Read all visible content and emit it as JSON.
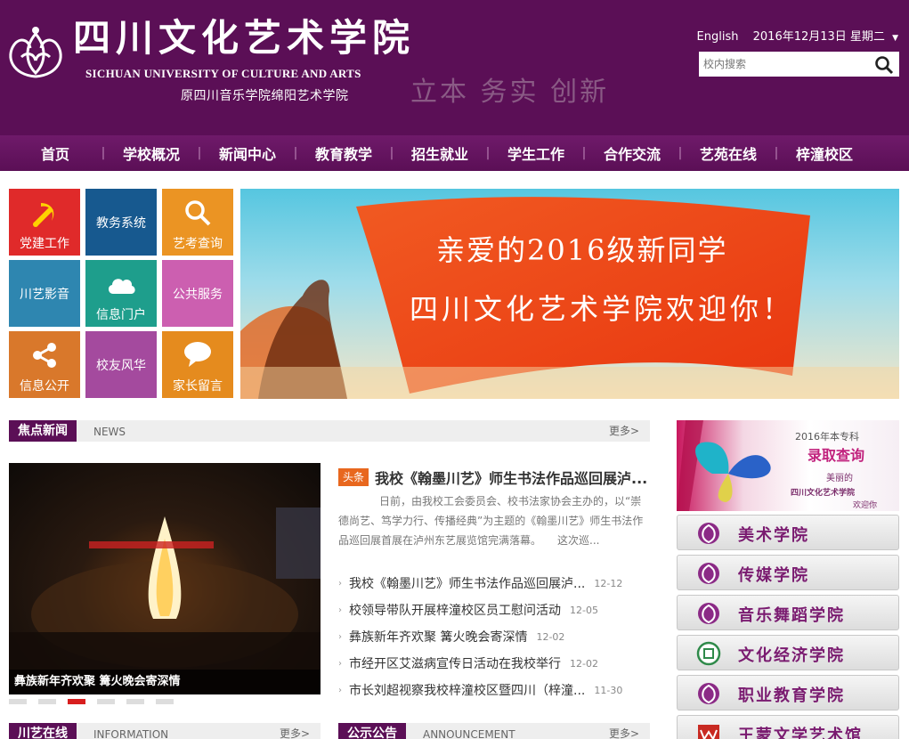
{
  "header": {
    "logo_cn": "四川文化艺术学院",
    "logo_en": "SICHUAN UNIVERSITY OF CULTURE AND ARTS",
    "logo_sub": "原四川音乐学院绵阳艺术学院",
    "motto": "立本 务实 创新",
    "english_link": "English",
    "date": "2016年12月13日 星期二",
    "search_placeholder": "校内搜索"
  },
  "nav": [
    "首页",
    "学校概况",
    "新闻中心",
    "教育教学",
    "招生就业",
    "学生工作",
    "合作交流",
    "艺苑在线",
    "梓潼校区"
  ],
  "tiles": [
    {
      "label": "党建工作",
      "color": "#e02a2a",
      "icon": "party-emblem-icon"
    },
    {
      "label": "教务系统",
      "color": "#17598f",
      "icon": ""
    },
    {
      "label": "艺考查询",
      "color": "#eb9423",
      "icon": "search-icon"
    },
    {
      "label": "川艺影音",
      "color": "#2e86b0",
      "icon": ""
    },
    {
      "label": "信息门户",
      "color": "#1e9e8c",
      "icon": "cloud-icon"
    },
    {
      "label": "公共服务",
      "color": "#cc5fb0",
      "icon": ""
    },
    {
      "label": "信息公开",
      "color": "#d9782b",
      "icon": "share-icon"
    },
    {
      "label": "校友风华",
      "color": "#a44a9e",
      "icon": ""
    },
    {
      "label": "家长留言",
      "color": "#e58b1e",
      "icon": "chat-icon"
    }
  ],
  "banner": {
    "line1": "亲爱的2016级新同学",
    "line2": "四川文化艺术学院欢迎你！"
  },
  "news": {
    "tab": "焦点新闻",
    "en": "NEWS",
    "more": "更多>",
    "photo_caption": "彝族新年齐欢聚 篝火晚会寄深情",
    "badge": "头条",
    "headline": "我校《翰墨川艺》师生书法作品巡回展泸...",
    "summary": "日前，由我校工会委员会、校书法家协会主办的，以“崇德尚艺、笃学力行、传播经典”为主题的《翰墨川艺》师生书法作品巡回展首展在泸州东艺展览馆完满落幕。　　这次巡...",
    "items": [
      {
        "text": "我校《翰墨川艺》师生书法作品巡回展泸...",
        "date": "12-12"
      },
      {
        "text": "校领导带队开展梓潼校区员工慰问活动",
        "date": "12-05"
      },
      {
        "text": "彝族新年齐欢聚 篝火晚会寄深情",
        "date": "12-02"
      },
      {
        "text": "市经开区艾滋病宣传日活动在我校举行",
        "date": "12-02"
      },
      {
        "text": "市长刘超视察我校梓潼校区暨四川（梓潼...",
        "date": "11-30"
      }
    ]
  },
  "bottom_sections": [
    {
      "tab": "川艺在线",
      "en": "INFORMATION",
      "more": "更多>"
    },
    {
      "tab": "公示公告",
      "en": "ANNOUNCEMENT",
      "more": "更多>"
    }
  ],
  "admission": {
    "year": "2016年本专科",
    "query": "录取查询",
    "slogan1": "美丽的",
    "slogan2": "四川文化艺术学院",
    "slogan3": "欢迎你"
  },
  "colleges": [
    "美术学院",
    "传媒学院",
    "音乐舞蹈学院",
    "文化经济学院",
    "职业教育学院",
    "王蒙文学艺术馆"
  ],
  "colors": {
    "brand_purple": "#5b0f56",
    "active_dot": "#d81e1e",
    "badge_orange": "#e8671e"
  }
}
